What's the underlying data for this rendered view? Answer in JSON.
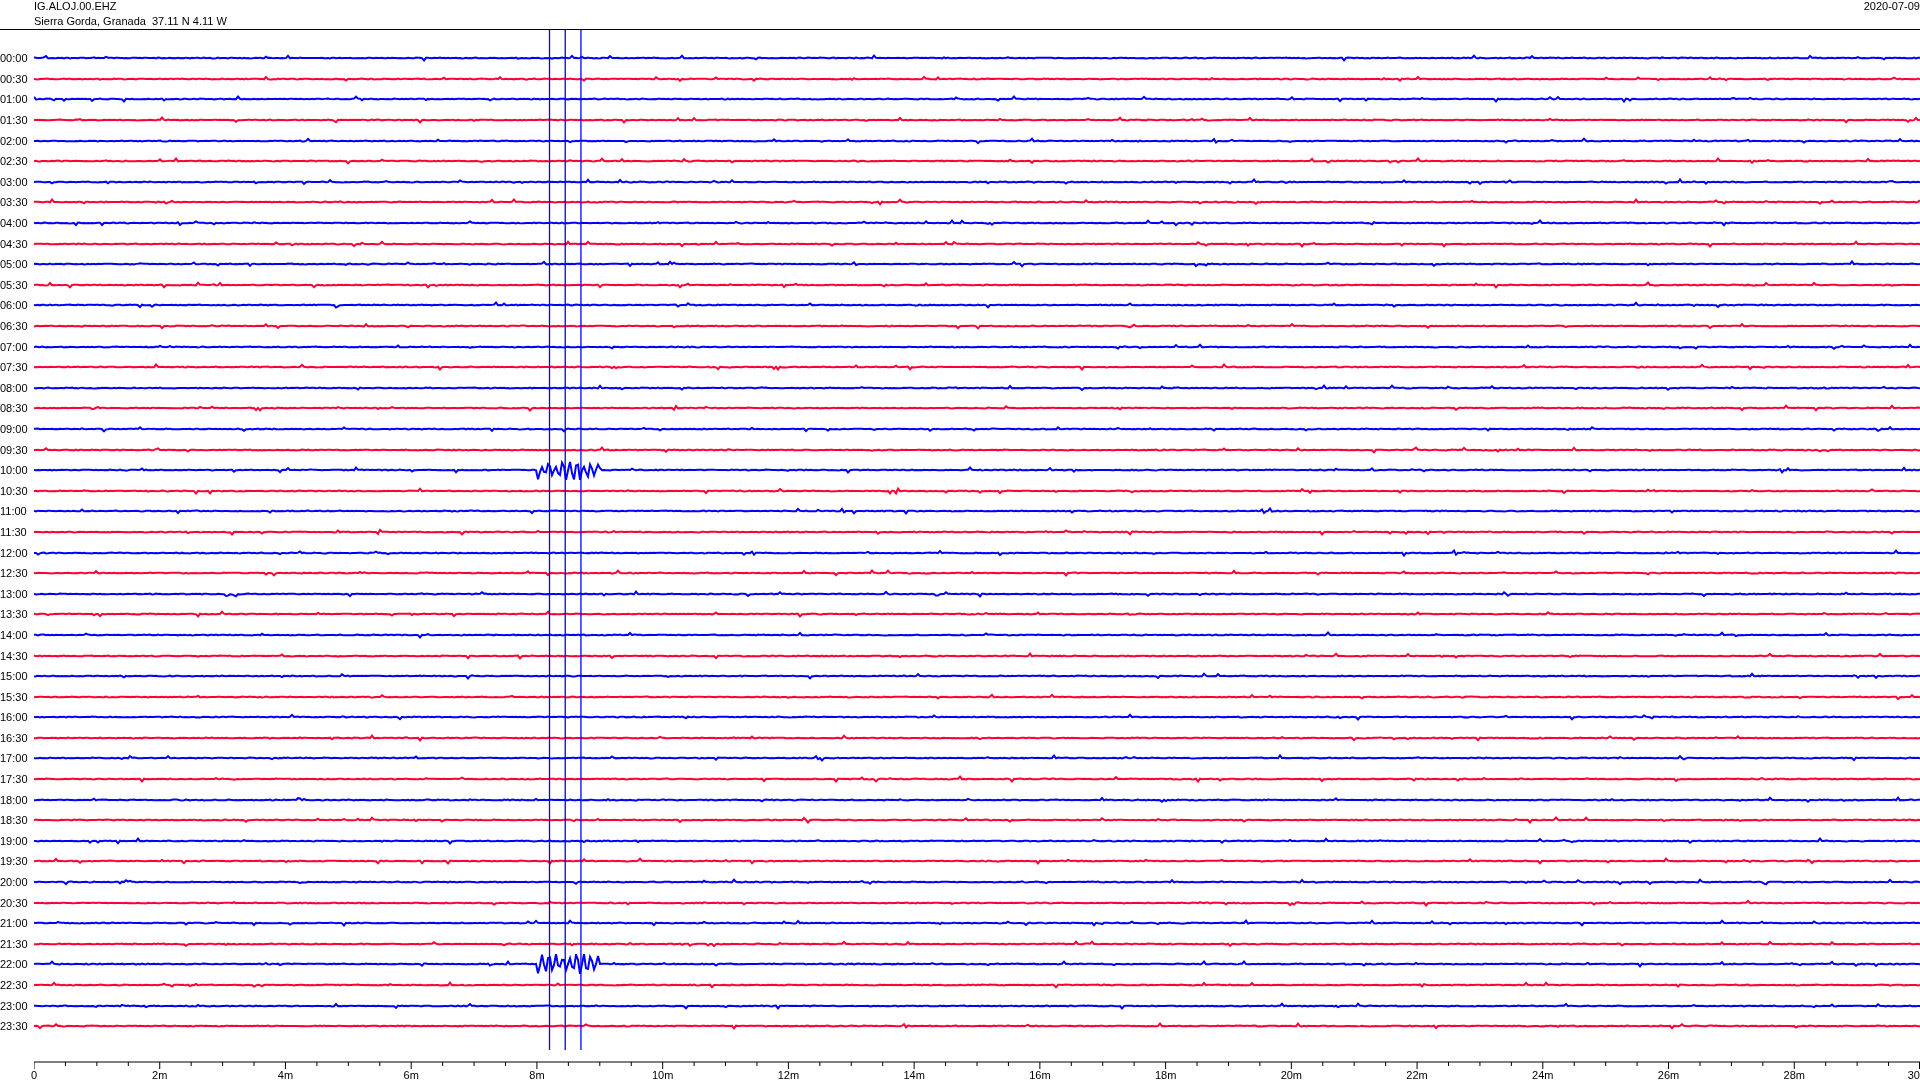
{
  "header": {
    "station": "IG.ALOJ.00.EHZ",
    "location": "Sierra Gorda, Granada  37.11 N 4.11 W",
    "date": "2020-07-09"
  },
  "rows": [
    {
      "label": "00:00",
      "color": "#0000ff"
    },
    {
      "label": "00:30",
      "color": "#ff0033"
    },
    {
      "label": "01:00",
      "color": "#0000ff"
    },
    {
      "label": "01:30",
      "color": "#ff0033"
    },
    {
      "label": "02:00",
      "color": "#0000ff"
    },
    {
      "label": "02:30",
      "color": "#ff0033"
    },
    {
      "label": "03:00",
      "color": "#0000ff"
    },
    {
      "label": "03:30",
      "color": "#ff0033"
    },
    {
      "label": "04:00",
      "color": "#0000ff"
    },
    {
      "label": "04:30",
      "color": "#ff0033"
    },
    {
      "label": "05:00",
      "color": "#0000ff"
    },
    {
      "label": "05:30",
      "color": "#ff0033"
    },
    {
      "label": "06:00",
      "color": "#0000ff"
    },
    {
      "label": "06:30",
      "color": "#ff0033"
    },
    {
      "label": "07:00",
      "color": "#0000ff"
    },
    {
      "label": "07:30",
      "color": "#ff0033"
    },
    {
      "label": "08:00",
      "color": "#0000ff"
    },
    {
      "label": "08:30",
      "color": "#ff0033"
    },
    {
      "label": "09:00",
      "color": "#0000ff"
    },
    {
      "label": "09:30",
      "color": "#ff0033"
    },
    {
      "label": "10:00",
      "color": "#0000ff"
    },
    {
      "label": "10:30",
      "color": "#ff0033"
    },
    {
      "label": "11:00",
      "color": "#0000ff"
    },
    {
      "label": "11:30",
      "color": "#ff0033"
    },
    {
      "label": "12:00",
      "color": "#0000ff"
    },
    {
      "label": "12:30",
      "color": "#ff0033"
    },
    {
      "label": "13:00",
      "color": "#0000ff"
    },
    {
      "label": "13:30",
      "color": "#ff0033"
    },
    {
      "label": "14:00",
      "color": "#0000ff"
    },
    {
      "label": "14:30",
      "color": "#ff0033"
    },
    {
      "label": "15:00",
      "color": "#0000ff"
    },
    {
      "label": "15:30",
      "color": "#ff0033"
    },
    {
      "label": "16:00",
      "color": "#0000ff"
    },
    {
      "label": "16:30",
      "color": "#ff0033"
    },
    {
      "label": "17:00",
      "color": "#0000ff"
    },
    {
      "label": "17:30",
      "color": "#ff0033"
    },
    {
      "label": "18:00",
      "color": "#0000ff"
    },
    {
      "label": "18:30",
      "color": "#ff0033"
    },
    {
      "label": "19:00",
      "color": "#0000ff"
    },
    {
      "label": "19:30",
      "color": "#ff0033"
    },
    {
      "label": "20:00",
      "color": "#0000ff"
    },
    {
      "label": "20:30",
      "color": "#ff0033"
    },
    {
      "label": "21:00",
      "color": "#0000ff"
    },
    {
      "label": "21:30",
      "color": "#ff0033"
    },
    {
      "label": "22:00",
      "color": "#0000ff"
    },
    {
      "label": "22:30",
      "color": "#ff0033"
    },
    {
      "label": "23:00",
      "color": "#0000ff"
    },
    {
      "label": "23:30",
      "color": "#ff0033"
    }
  ],
  "x_axis": {
    "ticks": [
      "0",
      "2m",
      "4m",
      "6m",
      "8m",
      "10m",
      "12m",
      "14m",
      "16m",
      "18m",
      "20m",
      "22m",
      "24m",
      "26m",
      "28m",
      "30"
    ]
  }
}
